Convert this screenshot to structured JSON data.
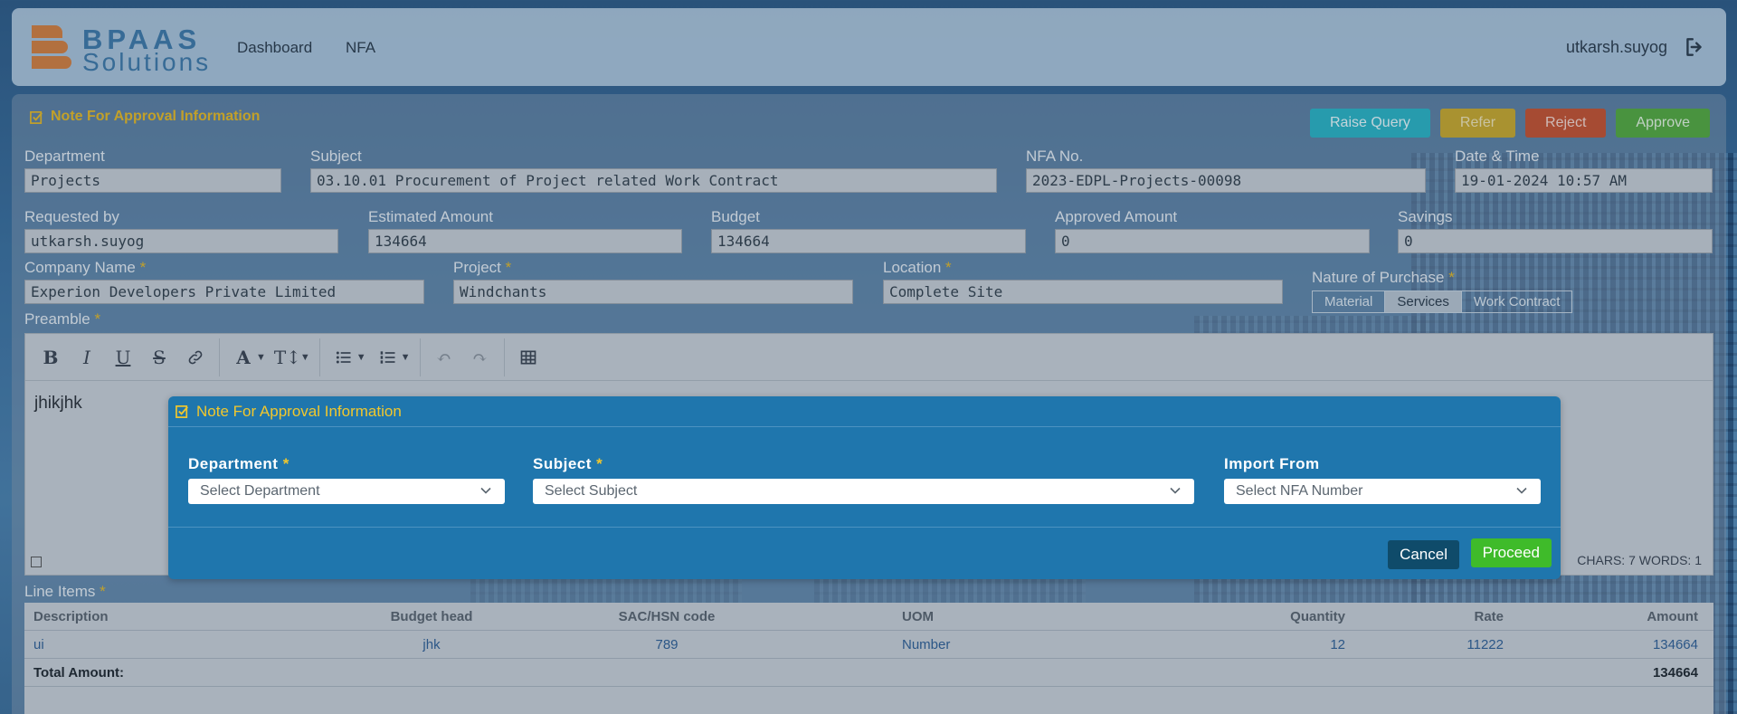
{
  "header": {
    "logo_line1": "BPAAS",
    "logo_line2": "Solutions",
    "nav": [
      "Dashboard",
      "NFA"
    ],
    "user": "utkarsh.suyog"
  },
  "form": {
    "section_title": "Note For Approval Information",
    "actions": {
      "raise_query": "Raise Query",
      "refer": "Refer",
      "reject": "Reject",
      "approve": "Approve"
    },
    "department": {
      "label": "Department",
      "value": "Projects"
    },
    "subject": {
      "label": "Subject",
      "value": "03.10.01 Procurement of Project related Work Contract"
    },
    "nfa_no": {
      "label": "NFA No.",
      "value": "2023-EDPL-Projects-00098"
    },
    "date_time": {
      "label": "Date & Time",
      "value": "19-01-2024 10:57 AM"
    },
    "requested_by": {
      "label": "Requested by",
      "value": "utkarsh.suyog"
    },
    "estimated_amount": {
      "label": "Estimated Amount",
      "value": "134664"
    },
    "budget": {
      "label": "Budget",
      "value": "134664"
    },
    "approved_amount": {
      "label": "Approved Amount",
      "value": "0"
    },
    "savings": {
      "label": "Savings",
      "value": "0"
    },
    "company_name": {
      "label": "Company Name",
      "value": "Experion Developers Private Limited"
    },
    "project": {
      "label": "Project",
      "value": "Windchants"
    },
    "location": {
      "label": "Location",
      "value": "Complete Site"
    },
    "nature_of_purchase": {
      "label": "Nature of Purchase",
      "options": [
        "Material",
        "Services",
        "Work Contract"
      ],
      "selected": "Services"
    },
    "required_mark": "*",
    "preamble": {
      "label": "Preamble",
      "content": "jhikjhk",
      "status": "CHARS: 7   WORDS: 1"
    },
    "line_items": {
      "label": "Line Items",
      "columns": [
        "Description",
        "Budget head",
        "SAC/HSN code",
        "UOM",
        "Quantity",
        "Rate",
        "Amount"
      ],
      "rows": [
        [
          "ui",
          "jhk",
          "789",
          "Number",
          "12",
          "11222",
          "134664"
        ]
      ],
      "total_label": "Total Amount:",
      "total_value": "134664"
    }
  },
  "modal": {
    "title": "Note For Approval Information",
    "department": {
      "label": "Department",
      "placeholder": "Select Department"
    },
    "subject": {
      "label": "Subject",
      "placeholder": "Select Subject"
    },
    "import_from": {
      "label": "Import From",
      "placeholder": "Select NFA Number"
    },
    "cancel": "Cancel",
    "proceed": "Proceed"
  },
  "colors": {
    "accent_yellow": "#e7b923",
    "modal_bg": "#1f76ad",
    "proceed_green": "#3fbb2a",
    "cancel_dark": "#0f4b6a"
  }
}
